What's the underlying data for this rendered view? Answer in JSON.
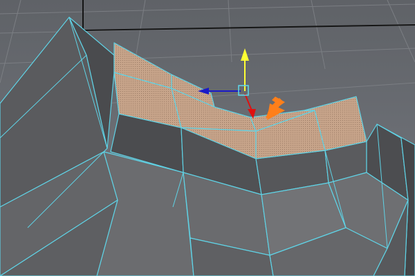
{
  "viewport": {
    "type": "3d-modeling-viewport",
    "background_color": "#6e7176",
    "grid_color": "#7a7d82",
    "grid_axis_color": "#1a1a1a",
    "mesh_face_color": "#58595b",
    "mesh_edge_color": "#5fd3e6",
    "selected_face_color": "#c7a48a",
    "selection": {
      "mode": "faces",
      "dot_pattern": true
    }
  },
  "manipulator": {
    "tool": "move-tool",
    "axes": [
      {
        "axis": "y",
        "color": "#ffff33",
        "icon": "arrow-up"
      },
      {
        "axis": "x",
        "color": "#1a1ac8",
        "icon": "arrow-left"
      },
      {
        "axis": "z",
        "color": "#e01010",
        "icon": "arrow-down"
      }
    ],
    "center_handle_color": "#5fd3e6"
  },
  "annotation": {
    "icon": "pointer-arrow",
    "color": "#ff7f1a"
  }
}
